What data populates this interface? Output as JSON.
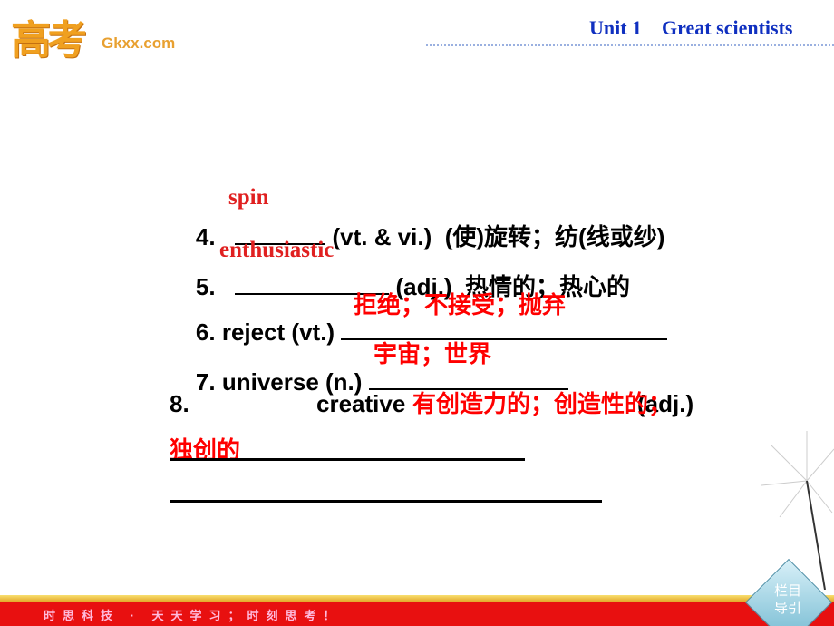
{
  "header": {
    "logo_cn": "高考",
    "logo_en": "Gkxx.com",
    "unit_title": "Unit 1    Great scientists"
  },
  "items": [
    {
      "num": "4.",
      "pre": "",
      "post": " (vt. & vi.)  (使)旋转；纺(线或纱)",
      "answer": "spin"
    },
    {
      "num": "5.",
      "pre": "",
      "post": " (adj.)  热情的；热心的",
      "answer": "enthusiastic"
    },
    {
      "num": "6.",
      "pre": "reject (vt.) ",
      "post": "",
      "answer": "拒绝；不接受；抛弃"
    },
    {
      "num": "7.",
      "pre": "universe (n.) ",
      "post": "",
      "answer": "宇宙；世界"
    },
    {
      "num": "8.",
      "pre": "creative",
      "post": "(adj.)",
      "answer": "有创造力的；创造性的；",
      "answer2": "独创的"
    }
  ],
  "footer": {
    "slogan": "时思科技 · 天天学习；时刻思考！",
    "nav_label": "栏目导引"
  },
  "colors": {
    "answer": "#ff0000",
    "unit_title": "#1030c0",
    "footer": "#e81010"
  }
}
